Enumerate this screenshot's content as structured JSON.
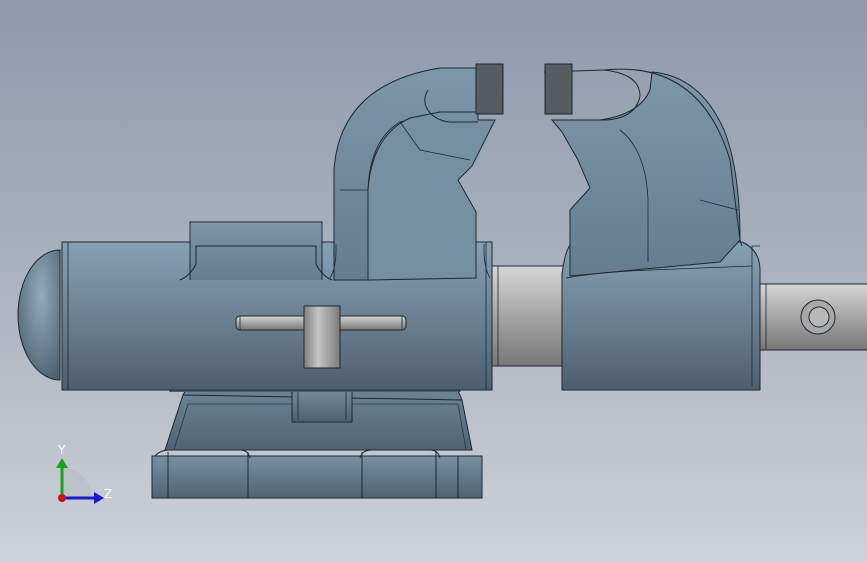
{
  "view": {
    "background_top": "#8e9aab",
    "background_bottom": "#cdd1d8",
    "part_color": "#6f8597",
    "shaft_color": "#a3a3a3"
  },
  "triad": {
    "y_label": "Y",
    "z_label": "Z",
    "y_color": "#1aa01a",
    "z_color": "#1a1acc",
    "x_color": "#d01010"
  }
}
